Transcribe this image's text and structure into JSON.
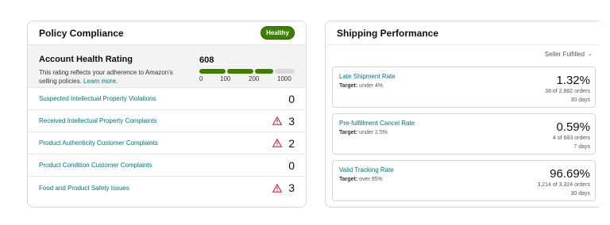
{
  "policy": {
    "title": "Policy Compliance",
    "badge": "Healthy",
    "badge_color": "#3f7f00",
    "ahr": {
      "title": "Account Health Rating",
      "desc": "This rating reflects your adherence to Amazon's selling policies.",
      "learn_more": "Learn more.",
      "score": "608",
      "ticks": [
        "0",
        "100",
        "200",
        "1000"
      ],
      "segments_filled": 3,
      "segments_total": 4
    },
    "rows": [
      {
        "label": "Suspected Intellectual Property Violations",
        "count": "0",
        "warning": false
      },
      {
        "label": "Received Intellectual Property Complaints",
        "count": "3",
        "warning": true
      },
      {
        "label": "Product Authenticity Customer Complaints",
        "count": "2",
        "warning": true
      },
      {
        "label": "Product Condition Customer Complaints",
        "count": "0",
        "warning": false
      },
      {
        "label": "Food and Product Safety Issues",
        "count": "3",
        "warning": true
      }
    ]
  },
  "shipping": {
    "title": "Shipping Performance",
    "filter": "Seller Fulfilled",
    "metrics": [
      {
        "name": "Late Shipment Rate",
        "target_label": "Target:",
        "target": "under 4%",
        "percent": "1.32%",
        "orders": "38 of 2,882 orders",
        "period": "30 days"
      },
      {
        "name": "Pre-fulfillment Cancel Rate",
        "target_label": "Target:",
        "target": "under 2.5%",
        "percent": "0.59%",
        "orders": "4 of 683 orders",
        "period": "7 days"
      },
      {
        "name": "Valid Tracking Rate",
        "target_label": "Target:",
        "target": "over 95%",
        "percent": "96.69%",
        "orders": "3,214 of 3,324 orders",
        "period": "30 days"
      }
    ]
  },
  "icons": {
    "warning": "warning-triangle-icon",
    "chevron": "chevron-down-icon"
  },
  "colors": {
    "link": "#007185",
    "warning": "#cc0c39",
    "healthy": "#3f7f00"
  }
}
